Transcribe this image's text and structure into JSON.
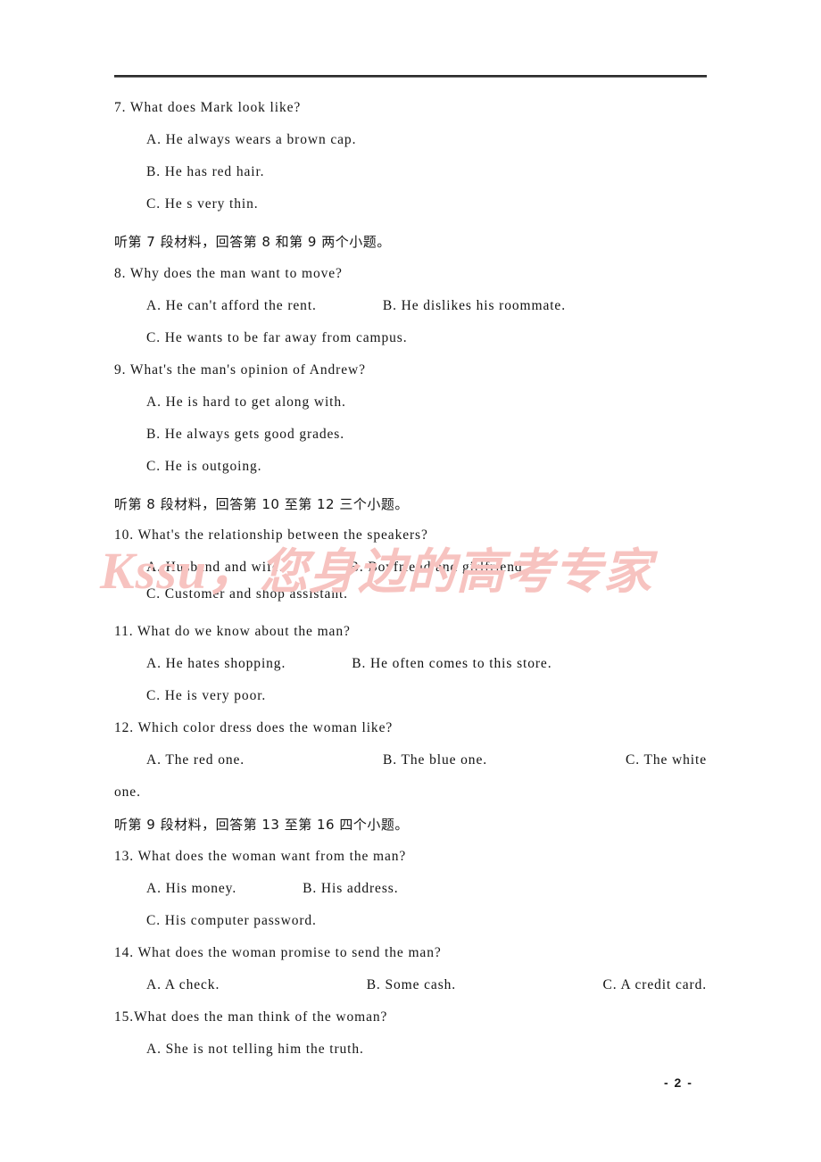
{
  "page": {
    "page_number_label": "- 2 -",
    "watermark_latin": "Kssu，",
    "watermark_cjk": "您身边的高考专家"
  },
  "content": {
    "q7": {
      "stem": "7. What does Mark look like?",
      "a": "A. He always wears a brown cap.",
      "b": "B. He has red hair.",
      "c": "C. He s very thin."
    },
    "instruction_7": "听第 7 段材料，回答第 8 和第 9 两个小题。",
    "q8": {
      "stem": "8. Why does the man want to move?",
      "a": "A. He can't afford the rent.",
      "b": "B. He dislikes his roommate.",
      "c": "C. He wants to be far away from campus."
    },
    "q9": {
      "stem": "9. What's the man's opinion of Andrew?",
      "a": "A. He is hard to get along with.",
      "b": "B. He always gets good grades.",
      "c": "C. He is outgoing."
    },
    "instruction_8": "听第 8 段材料，回答第 10 至第 12 三个小题。",
    "q10": {
      "stem": "10. What's the relationship between the speakers?",
      "a": "A. Husband and wife.",
      "b": "B. Boyfriend and girlfriend.",
      "c": "C. Customer and shop assistant."
    },
    "q11": {
      "stem": "11. What do we know about the man?",
      "a": "A. He hates shopping.",
      "b": "B. He often comes to this store.",
      "c": "C. He is very poor."
    },
    "q12": {
      "stem": "12. Which color dress does the woman like?",
      "a": "A. The red one.",
      "b": "B. The blue one.",
      "c": "C. The white",
      "c_wrap": "one."
    },
    "instruction_9": "听第 9 段材料，回答第 13 至第 16 四个小题。",
    "q13": {
      "stem": "13. What does the woman want from the man?",
      "a": "A. His money.",
      "b": "B. His address.",
      "c": "C. His computer password."
    },
    "q14": {
      "stem": "14. What does the woman promise to send the man?",
      "a": "A. A check.",
      "b": "B. Some cash.",
      "c": "C. A credit card."
    },
    "q15": {
      "stem": "15.What does the man think of the woman?",
      "a": "A. She is not telling him the truth."
    }
  }
}
